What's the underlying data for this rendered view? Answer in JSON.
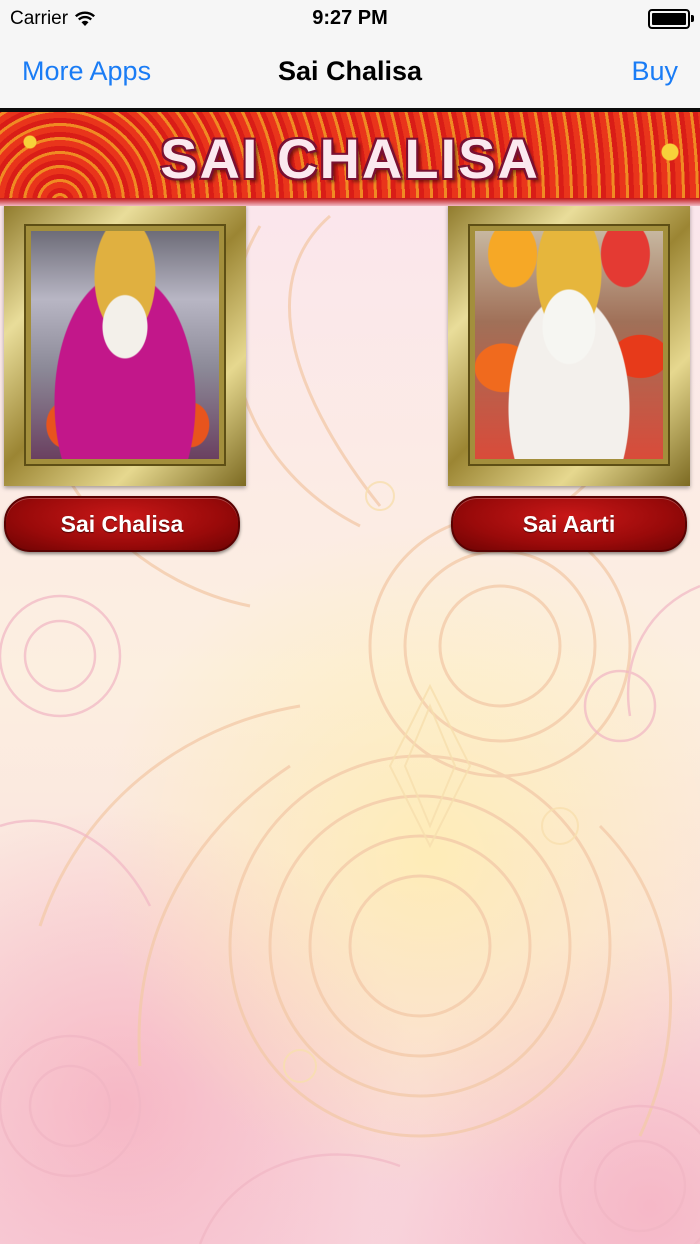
{
  "status_bar": {
    "carrier": "Carrier",
    "time": "9:27 PM"
  },
  "nav": {
    "left_label": "More Apps",
    "title": "Sai Chalisa",
    "right_label": "Buy"
  },
  "banner": {
    "title": "SAI CHALISA"
  },
  "items": [
    {
      "label": "Sai Chalisa",
      "image": "sai-baba-idol-purple-robe"
    },
    {
      "label": "Sai Aarti",
      "image": "sai-baba-idol-white-robe-garlands"
    }
  ],
  "colors": {
    "link": "#1a7cf5",
    "button_red": "#9a0a0a",
    "banner_red": "#e42a1a"
  }
}
